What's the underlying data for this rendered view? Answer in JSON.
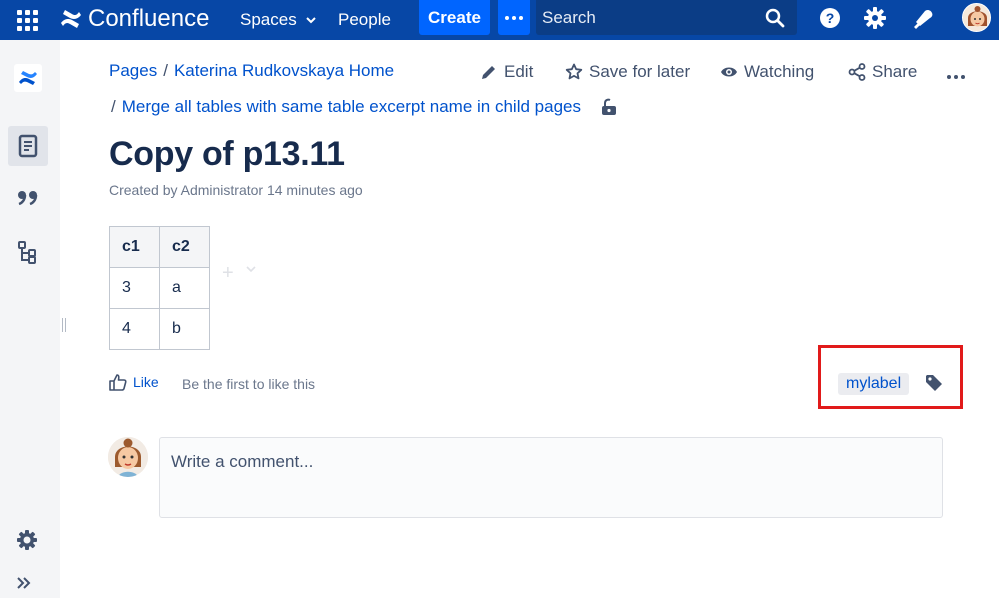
{
  "topbar": {
    "brand": "Confluence",
    "spaces": "Spaces",
    "people": "People",
    "create": "Create",
    "search_placeholder": "Search",
    "colors": {
      "bar": "#0747a6",
      "create": "#0065ff"
    }
  },
  "breadcrumbs": {
    "pages": "Pages",
    "separator": "/",
    "home": "Katerina Rudkovskaya Home",
    "parent": "Merge all tables with same table excerpt name in child pages"
  },
  "actions": {
    "edit": "Edit",
    "save": "Save for later",
    "watching": "Watching",
    "share": "Share"
  },
  "page": {
    "title": "Copy of p13.11",
    "byline": "Created by Administrator 14 minutes ago"
  },
  "table": {
    "headers": [
      "c1",
      "c2"
    ],
    "rows": [
      [
        "3",
        "a"
      ],
      [
        "4",
        "b"
      ]
    ]
  },
  "like": {
    "label": "Like",
    "hint": "Be the first to like this"
  },
  "labels": [
    "mylabel"
  ],
  "comment": {
    "placeholder": "Write a comment..."
  },
  "icons": {
    "topbar": [
      "app-switcher-icon",
      "confluence-logo-icon",
      "chevron-down-icon",
      "more-icon",
      "search-icon",
      "help-icon",
      "settings-icon",
      "notifications-icon"
    ],
    "sidebar": [
      "confluence-space-icon",
      "pages-icon",
      "blog-quote-icon",
      "page-tree-icon",
      "space-settings-icon",
      "expand-sidebar-icon"
    ]
  },
  "highlight_color": "#e11a1a"
}
